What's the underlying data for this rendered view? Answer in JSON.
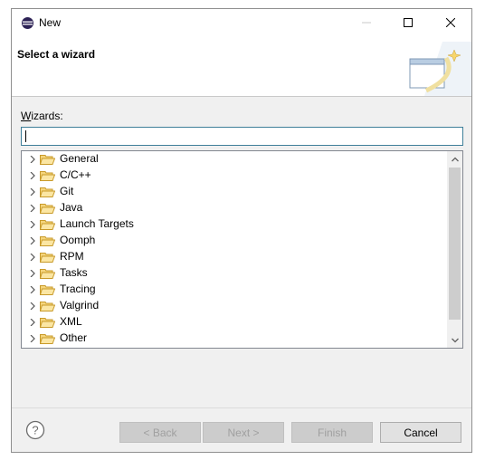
{
  "window": {
    "title": "New"
  },
  "header": {
    "title": "Select a wizard"
  },
  "filter": {
    "label": "Wizards:",
    "label_mnemonic": "W",
    "label_rest": "izards:",
    "value": "",
    "placeholder": ""
  },
  "tree": {
    "items": [
      {
        "label": "General"
      },
      {
        "label": "C/C++"
      },
      {
        "label": "Git"
      },
      {
        "label": "Java"
      },
      {
        "label": "Launch Targets"
      },
      {
        "label": "Oomph"
      },
      {
        "label": "RPM"
      },
      {
        "label": "Tasks"
      },
      {
        "label": "Tracing"
      },
      {
        "label": "Valgrind"
      },
      {
        "label": "XML"
      },
      {
        "label": "Other"
      }
    ]
  },
  "buttons": {
    "back": "< Back",
    "next": "Next >",
    "finish": "Finish",
    "cancel": "Cancel"
  },
  "colors": {
    "accent": "#3f7f99",
    "folder": "#e8b84a",
    "window_bg": "#f0f0f0"
  },
  "icons": {
    "app": "eclipse-icon",
    "help": "help-icon",
    "folder": "folder-icon",
    "expander": "chevron-right-icon"
  }
}
